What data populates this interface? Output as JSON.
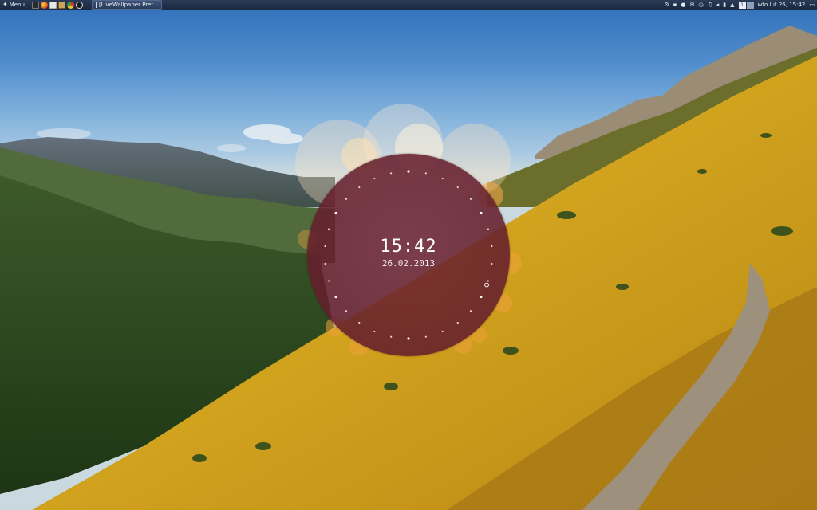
{
  "panel": {
    "menu_label": "Menu",
    "task_title": "[LiveWallpaper Pref...",
    "clock_text": "wto lut 26, 15:42",
    "workspaces": [
      "1",
      ""
    ],
    "tray_icons": [
      "network-icon",
      "notes-icon",
      "chat-icon",
      "mail-icon",
      "clock-icon",
      "music-icon",
      "volume-icon",
      "battery-icon",
      "up-arrow-icon"
    ]
  },
  "clock_widget": {
    "time": "15:42",
    "date": "26.02.2013"
  },
  "colors": {
    "panel_bg": "#1b2940",
    "clock_face": "#6e2330",
    "accent_orange": "#f0a23a"
  }
}
